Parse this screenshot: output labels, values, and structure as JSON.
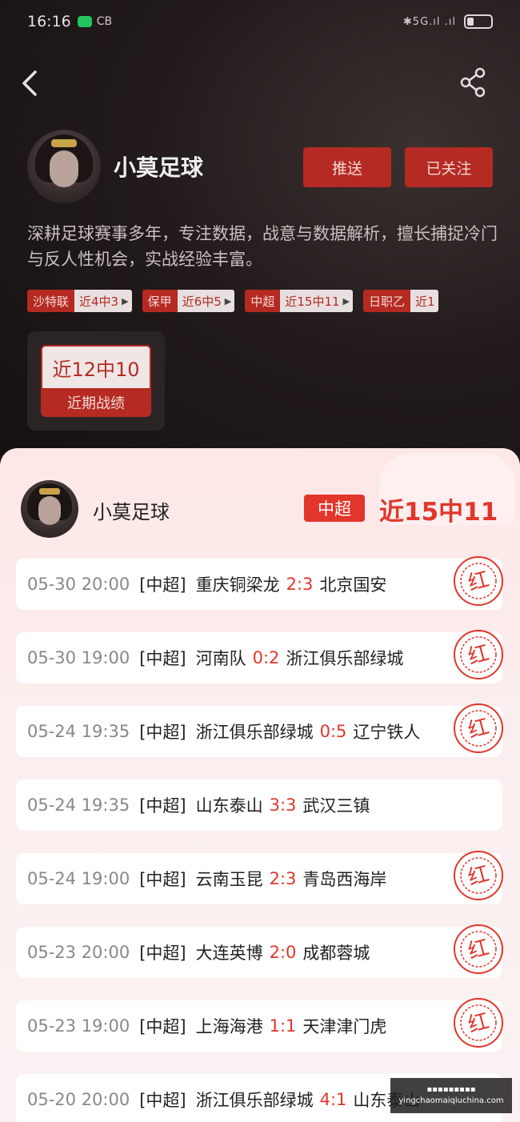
{
  "status_bar": {
    "time": "16:16",
    "sim_label": "CB",
    "signal_text": "✱5G.ıl .ıl",
    "battery_icon": "battery-low-icon",
    "wechat_icon": "wechat-icon"
  },
  "nav": {
    "back_icon": "chevron-left-icon",
    "share_icon": "share-icon"
  },
  "profile": {
    "name": "小莫足球",
    "push_label": "推送",
    "follow_label": "已关注",
    "bio": "深耕足球赛事多年，专注数据，战意与数据解析，擅长捕捉冷门与反人性机会，实战经验丰富。",
    "tags": [
      {
        "league": "沙特联",
        "record": "近4中3"
      },
      {
        "league": "保甲",
        "record": "近6中5"
      },
      {
        "league": "中超",
        "record": "近15中11"
      },
      {
        "league": "日职乙",
        "record": "近1"
      }
    ],
    "recent": {
      "record": "近12中10",
      "label": "近期战绩"
    }
  },
  "sheet": {
    "name": "小莫足球",
    "league": "中超",
    "record": "近15中11",
    "stamp_text": "红",
    "matches": [
      {
        "datetime": "05-30 20:00",
        "league": "[中超]",
        "home": "重庆铜梁龙",
        "score": "2:3",
        "away": "北京国安",
        "hit": true
      },
      {
        "datetime": "05-30 19:00",
        "league": "[中超]",
        "home": "河南队",
        "score": "0:2",
        "away": "浙江俱乐部绿城",
        "hit": true
      },
      {
        "datetime": "05-24 19:35",
        "league": "[中超]",
        "home": "浙江俱乐部绿城",
        "score": "0:5",
        "away": "辽宁铁人",
        "hit": true
      },
      {
        "datetime": "05-24 19:35",
        "league": "[中超]",
        "home": "山东泰山",
        "score": "3:3",
        "away": "武汉三镇",
        "hit": false
      },
      {
        "datetime": "05-24 19:00",
        "league": "[中超]",
        "home": "云南玉昆",
        "score": "2:3",
        "away": "青岛西海岸",
        "hit": true
      },
      {
        "datetime": "05-23 20:00",
        "league": "[中超]",
        "home": "大连英博",
        "score": "2:0",
        "away": "成都蓉城",
        "hit": true
      },
      {
        "datetime": "05-23 19:00",
        "league": "[中超]",
        "home": "上海海港",
        "score": "1:1",
        "away": "天津津门虎",
        "hit": true
      },
      {
        "datetime": "05-20 20:00",
        "league": "[中超]",
        "home": "浙江俱乐部绿城",
        "score": "4:1",
        "away": "山东泰山",
        "hit": false
      }
    ]
  },
  "watermark": {
    "line1": "▪▪▪▪▪▪▪▪▪",
    "line2": "yingchaomaiqiuchina.com"
  },
  "colors": {
    "accent": "#e2362b",
    "button": "#b52a22",
    "sheet_bg": "#fde7e6"
  }
}
